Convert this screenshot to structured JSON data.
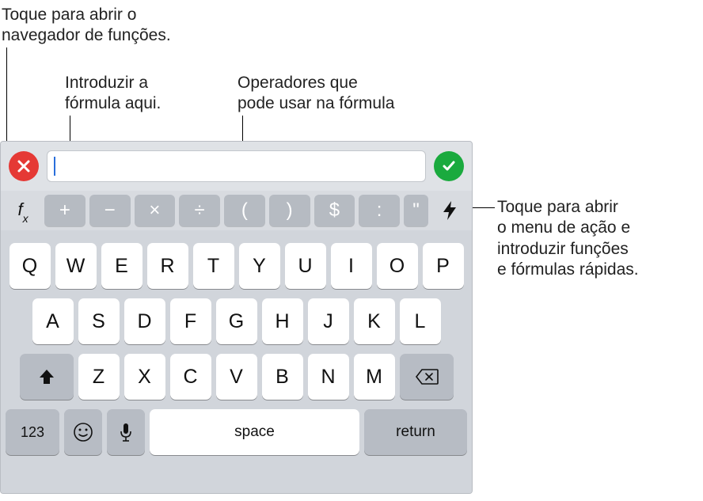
{
  "callouts": {
    "top_left": "Toque para abrir o\nnavegador de funções.",
    "top_mid_left": "Introduzir a\nfórmula aqui.",
    "top_mid_right": "Operadores que\npode usar na fórmula",
    "right": "Toque para abrir\no menu de ação e\nintroduzir funções\ne fórmulas rápidas."
  },
  "formula_bar": {
    "cancel_icon": "cancel",
    "confirm_icon": "confirm",
    "input_value": ""
  },
  "fx_label": "fx",
  "operator_row": [
    "+",
    "−",
    "×",
    "÷",
    "(",
    ")",
    "$",
    ":",
    "\""
  ],
  "bolt_icon": "bolt",
  "keyboard": {
    "row1": [
      "Q",
      "W",
      "E",
      "R",
      "T",
      "Y",
      "U",
      "I",
      "O",
      "P"
    ],
    "row2": [
      "A",
      "S",
      "D",
      "F",
      "G",
      "H",
      "J",
      "K",
      "L"
    ],
    "row3": [
      "Z",
      "X",
      "C",
      "V",
      "B",
      "N",
      "M"
    ],
    "shift_icon": "shift",
    "backspace_icon": "backspace",
    "numbers_label": "123",
    "emoji_icon": "emoji",
    "mic_icon": "mic",
    "space_label": "space",
    "return_label": "return"
  }
}
